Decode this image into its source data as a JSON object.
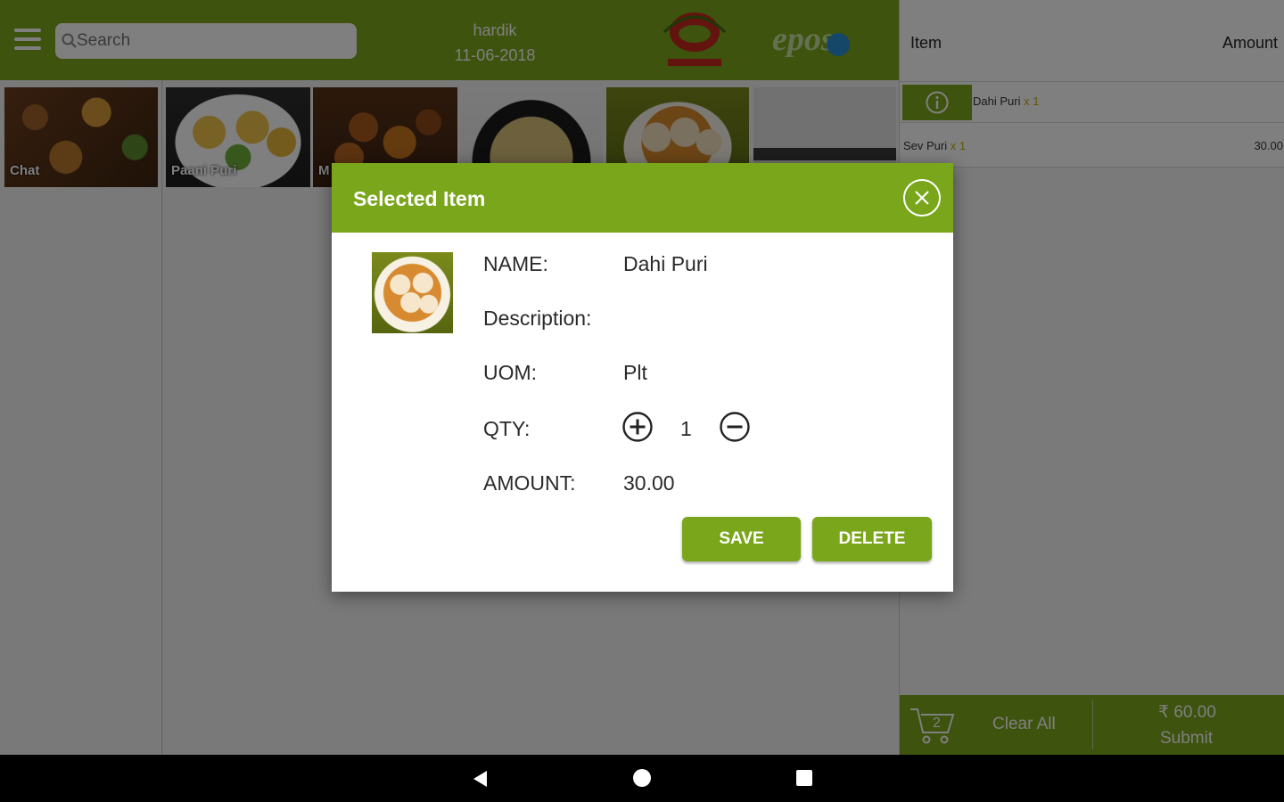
{
  "header": {
    "search_placeholder": "Search",
    "user_name": "hardik",
    "date": "11-06-2018",
    "logo_text": "epos"
  },
  "categories": [
    {
      "label": "Chat"
    }
  ],
  "products": [
    {
      "label": "Paani Puri"
    },
    {
      "label": "M"
    },
    {
      "label": ""
    },
    {
      "label": ""
    },
    {
      "label": ""
    }
  ],
  "cart": {
    "col_item": "Item",
    "col_amount": "Amount",
    "rows": [
      {
        "name": "Dahi Puri",
        "qty": "x 1",
        "amount": ""
      },
      {
        "name": "Sev Puri",
        "qty": "x 1",
        "amount": "30.00"
      }
    ],
    "count": "2",
    "clear_all": "Clear All",
    "total": "₹ 60.00",
    "submit": "Submit"
  },
  "dialog": {
    "title": "Selected Item",
    "name_label": "NAME:",
    "name_value": "Dahi Puri",
    "description_label": "Description:",
    "description_value": "",
    "uom_label": "UOM:",
    "uom_value": "Plt",
    "qty_label": "QTY:",
    "qty_value": "1",
    "amount_label": "AMOUNT:",
    "amount_value": "30.00",
    "save_label": "SAVE",
    "delete_label": "DELETE"
  },
  "colors": {
    "brand_green": "#7aa61c",
    "overlay": "rgba(0,0,0,0.5)"
  },
  "icons": [
    "menu-icon",
    "search-icon",
    "info-icon",
    "cart-icon",
    "close-icon",
    "plus-circle-icon",
    "minus-circle-icon",
    "back-icon",
    "home-icon",
    "recents-icon"
  ]
}
